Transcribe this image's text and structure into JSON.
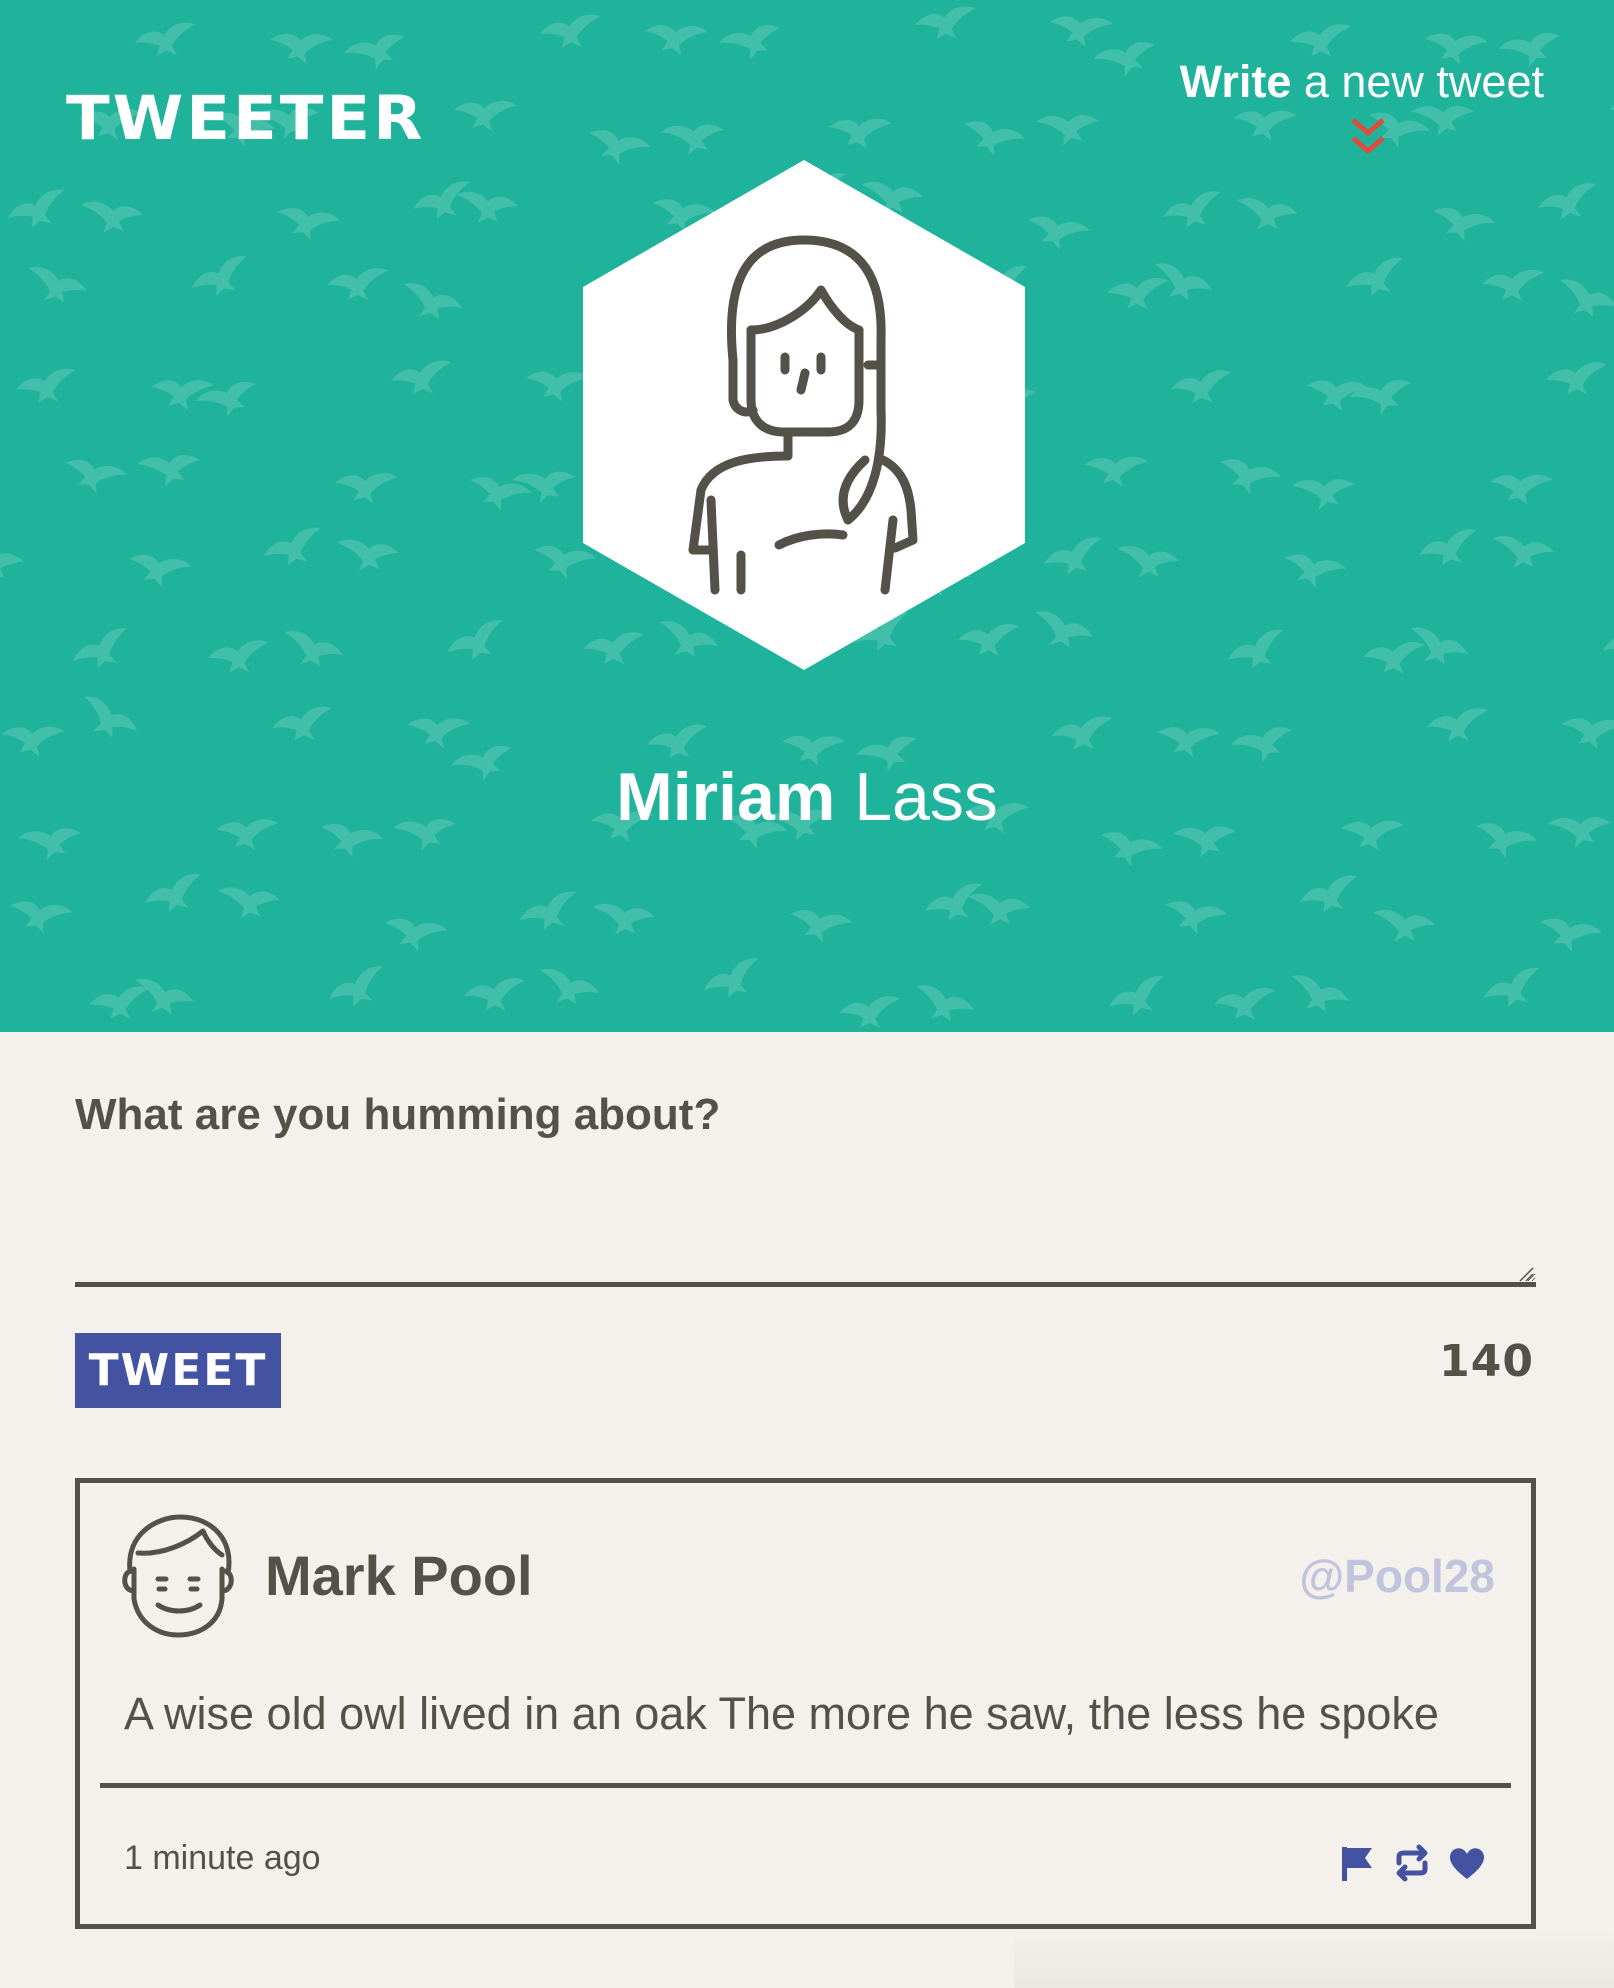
{
  "header": {
    "logo": "TWEETER",
    "write_link": {
      "bold": "Write",
      "rest": " a new tweet"
    },
    "accent_color": "#20b39b",
    "chevron_color": "#e14b3b"
  },
  "profile": {
    "first_name": "Miriam",
    "last_name": " Lass",
    "avatar_icon": "woman-avatar-icon"
  },
  "compose": {
    "label": "What are you humming about?",
    "value": "",
    "button_label": "TWEET",
    "char_count": "140",
    "button_color": "#4353a1"
  },
  "tweets": [
    {
      "author": "Mark Pool",
      "handle": "@Pool28",
      "text": "A wise old owl lived in an oak The more he saw, the less he spoke",
      "time": "1 minute ago",
      "avatar_icon": "man-avatar-icon",
      "actions": [
        "flag-icon",
        "retweet-icon",
        "heart-icon"
      ],
      "action_color": "#4353a1"
    }
  ]
}
